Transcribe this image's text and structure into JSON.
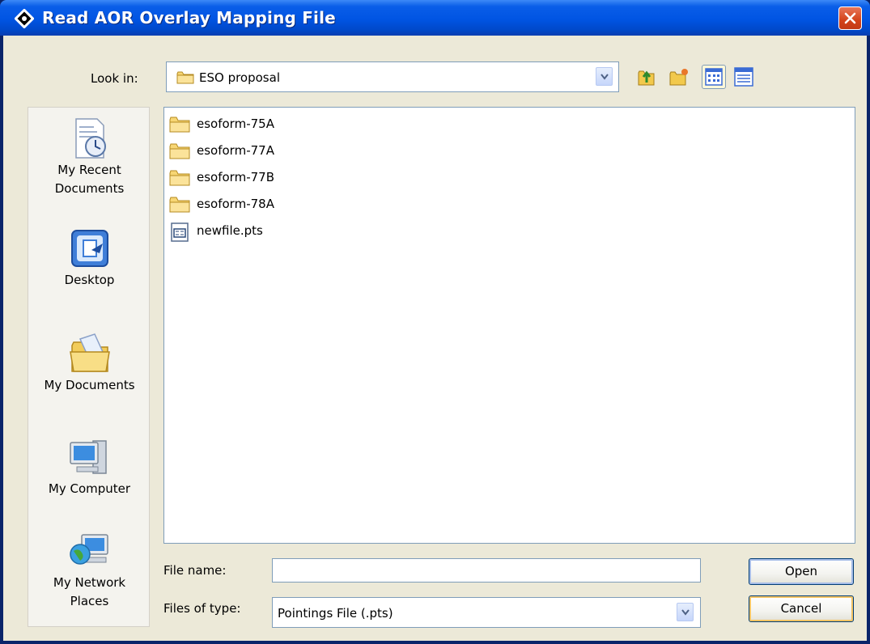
{
  "window": {
    "title": "Read AOR Overlay Mapping File"
  },
  "look_in": {
    "label": "Look in:",
    "value": "ESO proposal"
  },
  "toolbar": {
    "icons": [
      "up-one-level-icon",
      "create-new-folder-icon",
      "list-view-icon",
      "details-view-icon"
    ]
  },
  "places": [
    {
      "label_line1": "My Recent",
      "label_line2": "Documents",
      "icon": "recent-documents-icon"
    },
    {
      "label_line1": "Desktop",
      "label_line2": "",
      "icon": "desktop-icon"
    },
    {
      "label_line1": "My Documents",
      "label_line2": "",
      "icon": "my-documents-icon"
    },
    {
      "label_line1": "My Computer",
      "label_line2": "",
      "icon": "my-computer-icon"
    },
    {
      "label_line1": "My Network",
      "label_line2": "Places",
      "icon": "network-places-icon"
    }
  ],
  "files": [
    {
      "name": "esoform-75A",
      "type": "folder"
    },
    {
      "name": "esoform-77A",
      "type": "folder"
    },
    {
      "name": "esoform-77B",
      "type": "folder"
    },
    {
      "name": "esoform-78A",
      "type": "folder"
    },
    {
      "name": "newfile.pts",
      "type": "file"
    }
  ],
  "file_name": {
    "label": "File name:",
    "value": ""
  },
  "file_type": {
    "label": "Files of type:",
    "value": "Pointings File (.pts)"
  },
  "buttons": {
    "open": "Open",
    "cancel": "Cancel"
  },
  "colors": {
    "titlebar": "#0054e3",
    "dialog_bg": "#ece9d8",
    "close": "#d3431a"
  }
}
